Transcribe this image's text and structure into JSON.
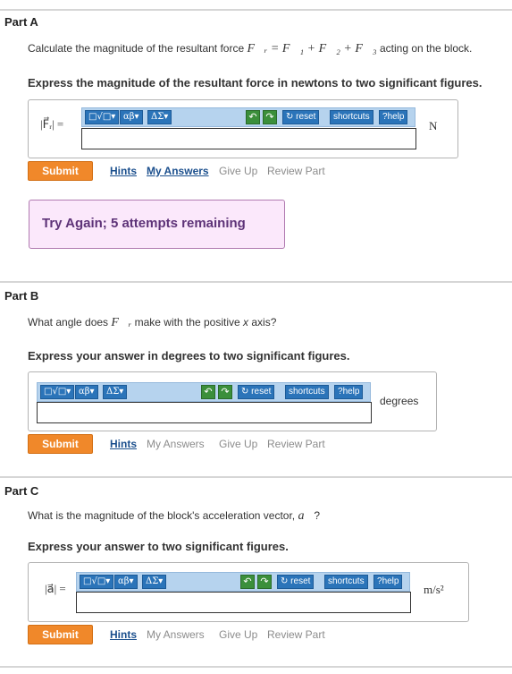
{
  "toolbar": {
    "template_label": "□√□",
    "greek_label": "αβ",
    "symbols_label": "ΔΣ",
    "undo_glyph": "↶",
    "redo_glyph": "↷",
    "reset_label": "reset",
    "shortcuts_label": "shortcuts",
    "help_label": "help",
    "reset_glyph": "↻",
    "help_glyph": "?",
    "caret": "▾"
  },
  "actions": {
    "submit_label": "Submit",
    "hints_label": "Hints",
    "my_answers_label": "My Answers",
    "give_up_label": "Give Up",
    "review_part_label": "Review Part"
  },
  "parts": [
    {
      "title": "Part A",
      "question_prefix": "Calculate the magnitude of the resultant force ",
      "question_math": "F⃗ᵣ = F⃗₁ + F⃗₂ + F⃗₃",
      "question_suffix": " acting on the block.",
      "instruction": "Express the magnitude of the resultant force in newtons to two significant figures.",
      "answer_label": "|F⃗ᵣ| =",
      "unit": "N",
      "feedback": "Try Again; 5 attempts remaining"
    },
    {
      "title": "Part B",
      "question_prefix": "What angle does ",
      "question_math": "F⃗ᵣ",
      "question_suffix_a": " make with the positive ",
      "question_var": "x",
      "question_suffix_b": " axis?",
      "instruction": "Express your answer in degrees to two significant figures.",
      "unit": "degrees"
    },
    {
      "title": "Part C",
      "question_prefix": "What is the magnitude of the block's acceleration vector, ",
      "question_math": "a⃗",
      "question_suffix": "?",
      "instruction": "Express your answer to two significant figures.",
      "answer_label": "|a⃗| =",
      "unit": "m/s²"
    }
  ]
}
